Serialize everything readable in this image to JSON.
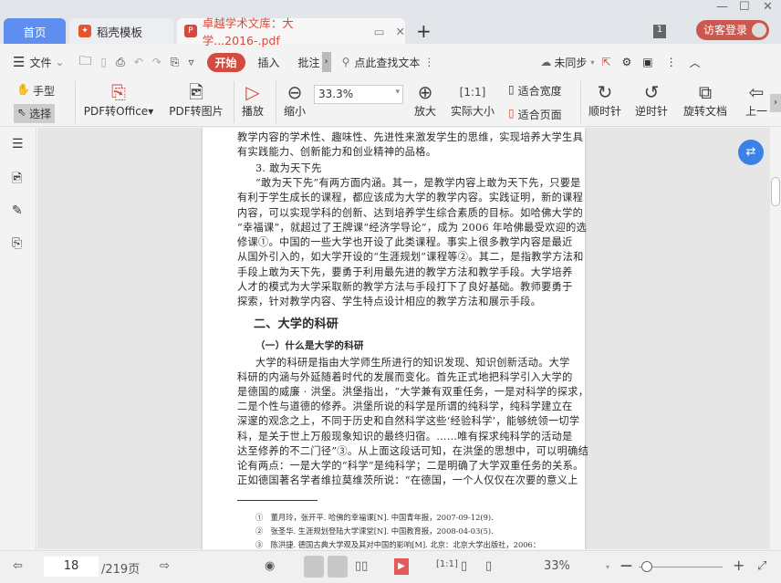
{
  "tabs": {
    "home": "首页",
    "template": "稻壳模板",
    "document": "卓越学术文库：大学...2016-.pdf",
    "badge_count": "1",
    "login": "访客登录"
  },
  "toolbar": {
    "file": "文件",
    "start": "开始",
    "insert": "插入",
    "annotate": "批注",
    "search": "点此查找文本",
    "sync": "未同步"
  },
  "ribbon": {
    "hand": "手型",
    "select": "选择",
    "pdf_to_office": "PDF转Office",
    "pdf_to_image": "PDF转图片",
    "play": "播放",
    "zoom_out": "缩小",
    "zoom_value": "33.3%",
    "zoom_in": "放大",
    "actual_size": "实际大小",
    "fit_width": "适合宽度",
    "fit_page": "适合页面",
    "clockwise": "顺时针",
    "counterclockwise": "逆时针",
    "rotate_doc": "旋转文档",
    "prev": "上一"
  },
  "document": {
    "lines1": [
      "教学内容的学术性、趣味性、先进性来激发学生的思维，实现培养大学生具",
      "有实践能力、创新能力和创业精神的品格。",
      "3. 敢为天下先",
      "“敢为天下先”有两方面内涵。其一，是教学内容上敢为天下先，只要是",
      "有利于学生成长的课程，都应该成为大学的教学内容。实践证明，新的课程",
      "内容，可以实现学科的创新、达到培养学生综合素质的目标。如哈佛大学的",
      "“幸福课”，就超过了王牌课“经济学导论”，成为 2006 年哈佛最受欢迎的选",
      "修课①。中国的一些大学也开设了此类课程。事实上很多教学内容是最近",
      "从国外引入的，如大学开设的“生涯规划”课程等②。其二，是指教学方法和",
      "手段上敢为天下先，要勇于利用最先进的教学方法和教学手段。大学培养",
      "人才的模式为大学采取新的教学方法与手段打下了良好基础。教师要勇于",
      "探索，针对教学内容、学生特点设计相应的教学方法和展示手段。"
    ],
    "heading": "二、大学的科研",
    "subheading": "（一）什么是大学的科研",
    "lines2": [
      "大学的科研是指由大学师生所进行的知识发现、知识创新活动。大学",
      "科研的内涵与外延随着时代的发展而变化。首先正式地把科学引入大学的",
      "是德国的威廉 · 洪堡。洪堡指出，“大学兼有双重任务，一是对科学的探求，",
      "二是个性与道德的修养。洪堡所说的科学是所谓的纯科学，纯科学建立在",
      "深邃的观念之上，不同于历史和自然科学这些‘经验科学’，能够统领一切学",
      "科，是关于世上万般现象知识的最终归宿。……唯有探求纯科学的活动是",
      "达至修养的不二门径”③。从上面这段话可知，在洪堡的思想中，可以明确结",
      "论有两点：一是大学的“科学”是纯科学；二是明确了大学双重任务的关系。",
      "正如德国著名学者维拉莫维茨所说：“在德国，一个人仅仅在次要的意义上"
    ],
    "footnotes": [
      "①　董月玲，张开平. 哈佛的幸福课[N]. 中国青年报，2007-09-12(9).",
      "②　张圣华. 生涯规划登陆大学课堂[N]. 中国教育报，2008-04-03(5).",
      "③　陈洪捷. 德国古典大学观及其对中国的影响[M]. 北京：北京大学出版社，2006："
    ]
  },
  "status": {
    "page": "18",
    "total": "/219页",
    "zoom": "33%",
    "zoom_fraction": 0.1
  },
  "colors": {
    "accent": "#d24b3e",
    "home_tab": "#5d8ef0"
  }
}
